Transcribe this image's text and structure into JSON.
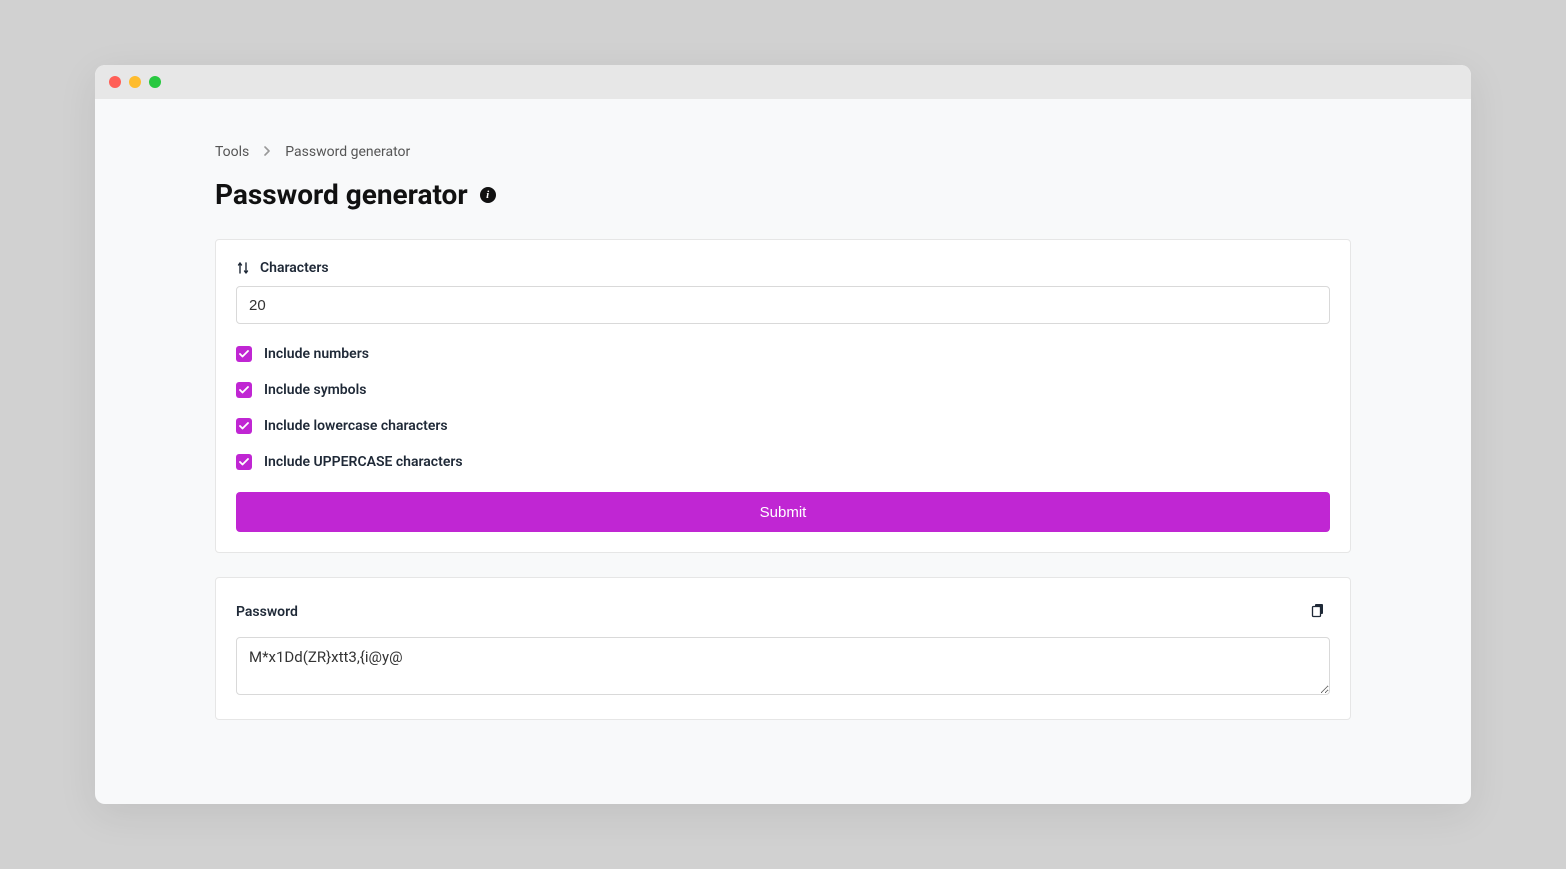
{
  "breadcrumb": {
    "root": "Tools",
    "current": "Password generator"
  },
  "page": {
    "title": "Password generator"
  },
  "form": {
    "characters_label": "Characters",
    "characters_value": "20",
    "checks": {
      "numbers": "Include numbers",
      "symbols": "Include symbols",
      "lowercase": "Include lowercase characters",
      "uppercase": "Include UPPERCASE characters"
    },
    "submit_label": "Submit"
  },
  "result": {
    "label": "Password",
    "value": "M*x1Dd(ZR}xtt3,{i@y@"
  },
  "colors": {
    "accent": "#c026d3"
  }
}
